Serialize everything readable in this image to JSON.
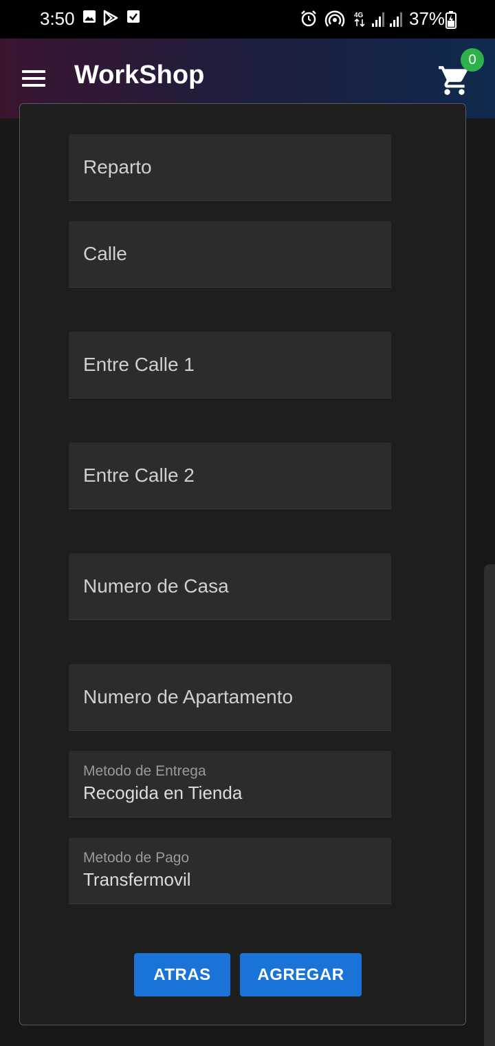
{
  "status_bar": {
    "time": "3:50",
    "battery": "37%",
    "icons": [
      "gallery-icon",
      "play-store-icon",
      "checkbox-icon",
      "alarm-icon",
      "hotspot-icon",
      "4g-icon",
      "signal-icon",
      "signal-icon",
      "battery-charging-icon"
    ]
  },
  "app_bar": {
    "title": "WorkShop",
    "cart_count": "0",
    "icons": [
      "menu-icon",
      "cart-icon"
    ]
  },
  "form": {
    "fields": [
      {
        "placeholder": "Reparto"
      },
      {
        "placeholder": "Calle"
      },
      {
        "placeholder": "Entre Calle 1"
      },
      {
        "placeholder": "Entre Calle 2"
      },
      {
        "placeholder": "Numero de Casa"
      },
      {
        "placeholder": "Numero de Apartamento"
      }
    ],
    "delivery": {
      "label": "Metodo de Entrega",
      "value": "Recogida en Tienda"
    },
    "payment": {
      "label": "Metodo de Pago",
      "value": "Transfermovil"
    }
  },
  "buttons": {
    "back": "ATRAS",
    "add": "AGREGAR"
  },
  "colors": {
    "accent": "#1a73d6",
    "badge": "#2db14a",
    "field_bg": "#2c2c2c",
    "background": "#181818"
  }
}
